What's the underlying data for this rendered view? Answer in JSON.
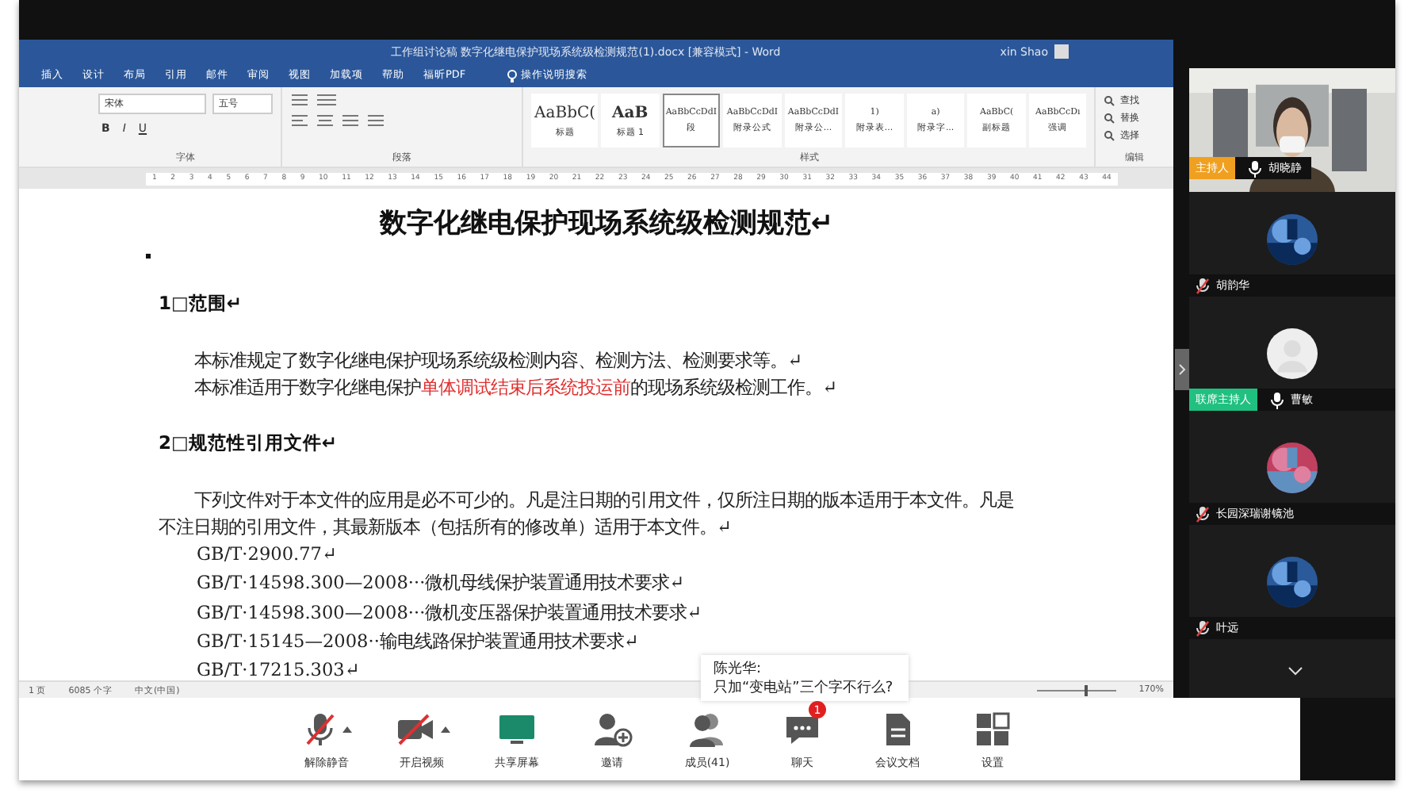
{
  "word": {
    "title": "工作组讨论稿 数字化继电保护现场系统级检测规范(1).docx [兼容模式] - Word",
    "user": "xin Shao",
    "tabs": [
      "插入",
      "设计",
      "布局",
      "引用",
      "邮件",
      "审阅",
      "视图",
      "加载项",
      "帮助",
      "福昕PDF"
    ],
    "search_hint": "操作说明搜索",
    "ribbon": {
      "font": "宋体",
      "size": "五号",
      "format_buttons": [
        "B",
        "I",
        "U"
      ],
      "styles": [
        {
          "preview": "AaBbC(",
          "name": "标题",
          "selected": false
        },
        {
          "preview": "AaB",
          "name": "标题 1",
          "selected": false
        },
        {
          "preview": "AaBbCcDdI",
          "name": "段",
          "selected": true
        },
        {
          "preview": "AaBbCcDdI",
          "name": "附录公式",
          "selected": false
        },
        {
          "preview": "AaBbCcDdI",
          "name": "附录公...",
          "selected": false
        },
        {
          "preview": "1)",
          "name": "附录表...",
          "selected": false
        },
        {
          "preview": "a)",
          "name": "附录字...",
          "selected": false
        },
        {
          "preview": "AaBbC(",
          "name": "副标题",
          "selected": false
        },
        {
          "preview": "AaBbCcDı",
          "name": "强调",
          "selected": false
        }
      ],
      "editing": [
        "查找",
        "替换",
        "选择"
      ],
      "groups": [
        "字体",
        "段落",
        "样式",
        "编辑"
      ]
    },
    "ruler": [
      "1",
      "2",
      "3",
      "4",
      "5",
      "6",
      "7",
      "8",
      "9",
      "10",
      "11",
      "12",
      "13",
      "14",
      "15",
      "16",
      "17",
      "18",
      "19",
      "20",
      "21",
      "22",
      "23",
      "24",
      "25",
      "26",
      "27",
      "28",
      "29",
      "30",
      "31",
      "32",
      "33",
      "34",
      "35",
      "36",
      "37",
      "38",
      "39",
      "40",
      "41",
      "42",
      "43",
      "44"
    ],
    "document": {
      "title": "数字化继电保护现场系统级检测规范↵",
      "blocks": [
        {
          "kind": "heading",
          "text": "1□范围↵"
        },
        {
          "kind": "para",
          "segments": [
            {
              "text": "本标准规定了数字化继电保护现场系统级检测内容、检测方法、检测要求等。↵",
              "marked": false
            }
          ]
        },
        {
          "kind": "para",
          "segments": [
            {
              "text": "本标准适用于数字化继电保护",
              "marked": false
            },
            {
              "text": "单体调试结束后系统投运前",
              "marked": true
            },
            {
              "text": "的现场系统级检测工作。↵",
              "marked": false
            }
          ]
        },
        {
          "kind": "heading",
          "text": "2□规范性引用文件↵"
        },
        {
          "kind": "para",
          "segments": [
            {
              "text": "下列文件对于本文件的应用是必不可少的。凡是注日期的引用文件，仅所注日期的版本适用于本文件。凡是不注日期的引用文件，其最新版本（包括所有的修改单）适用于本文件。↵",
              "marked": false
            }
          ]
        },
        {
          "kind": "ref",
          "text": "GB/T·2900.77↵"
        },
        {
          "kind": "ref",
          "text": "GB/T·14598.300—2008···微机母线保护装置通用技术要求↵"
        },
        {
          "kind": "ref",
          "text": "GB/T·14598.300—2008···微机变压器保护装置通用技术要求↵"
        },
        {
          "kind": "ref",
          "text": "GB/T·15145—2008··输电线路保护装置通用技术要求↵"
        },
        {
          "kind": "ref",
          "text": "GB/T·17215.303↵"
        }
      ]
    },
    "status": {
      "page": "1 页",
      "words": "6085 个字",
      "language": "中文(中国)",
      "zoom": "170%",
      "zoom_slider": {
        "level": 0.6
      }
    }
  },
  "chat_popup": {
    "sender": "陈光华:",
    "message": "只加“变电站”三个字不行么?"
  },
  "participants": [
    {
      "kind": "video",
      "role": "主持人",
      "color": "#f0a020",
      "name": "胡晓静",
      "muted": false
    },
    {
      "name": "胡韵华",
      "muted": true
    },
    {
      "kind": "default",
      "role": "联席主持人",
      "color": "#20c080",
      "name": "曹敏",
      "muted": false
    },
    {
      "name": "长园深瑞谢镜池",
      "muted": true
    },
    {
      "name": "叶远",
      "muted": true
    }
  ],
  "toolbar": [
    {
      "kind": "mic-off",
      "label": "解除静音",
      "caret": true
    },
    {
      "kind": "video-off",
      "label": "开启视频",
      "caret": true
    },
    {
      "kind": "screen",
      "label": "共享屏幕",
      "caret": false
    },
    {
      "kind": "invite",
      "label": "邀请",
      "caret": false
    },
    {
      "kind": "members",
      "label": "成员(41)",
      "caret": false
    },
    {
      "kind": "chat",
      "label": "聊天",
      "caret": false,
      "badge": "1"
    },
    {
      "kind": "doc",
      "label": "会议文档",
      "caret": false
    },
    {
      "kind": "settings",
      "label": "设置",
      "caret": false
    }
  ]
}
